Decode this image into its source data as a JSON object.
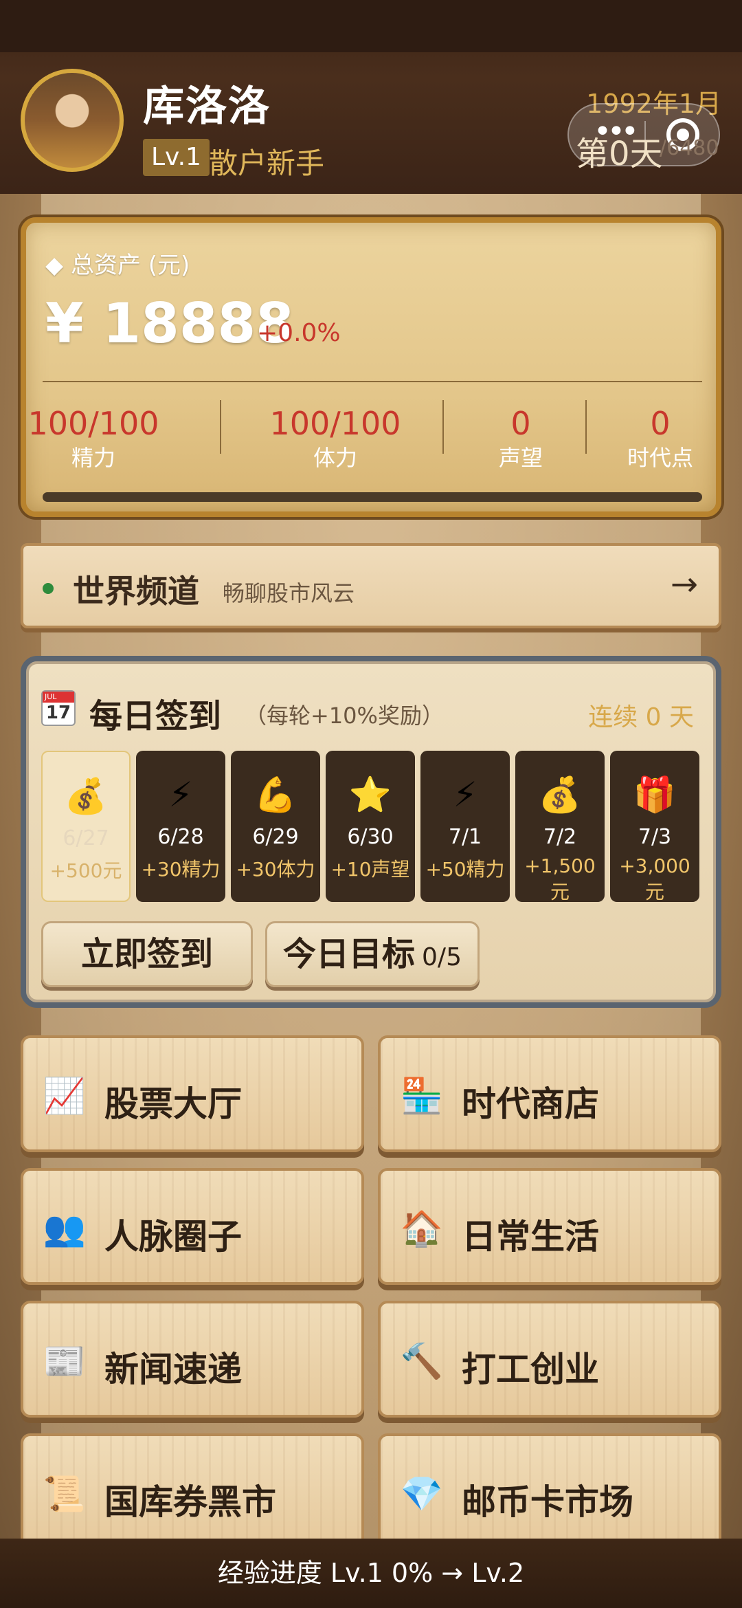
{
  "header": {
    "username": "库洛洛",
    "level": "Lv.1",
    "title": "散户新手",
    "date": "1992年1月",
    "day": "第0天",
    "day_total": "/6480"
  },
  "assets": {
    "label": "◆ 总资产 (元)",
    "value": "¥ 18888",
    "change": "+0.0%",
    "stats": [
      {
        "value": "100/100",
        "label": "精力"
      },
      {
        "value": "100/100",
        "label": "体力"
      },
      {
        "value": "0",
        "label": "声望"
      },
      {
        "value": "0",
        "label": "时代点"
      }
    ]
  },
  "channel": {
    "title": "世界频道",
    "subtitle": "畅聊股市风云",
    "arrow": "→"
  },
  "checkin": {
    "cal_month": "JUL",
    "cal_day": "17",
    "title": "每日签到",
    "bonus": "（每轮+10%奖励）",
    "streak": "连续 0 天",
    "days": [
      {
        "icon": "money-bag-icon",
        "glyph": "💰",
        "date": "6/27",
        "reward": "+500元",
        "done": true
      },
      {
        "icon": "lightning-icon",
        "glyph": "⚡",
        "date": "6/28",
        "reward": "+30精力",
        "done": false
      },
      {
        "icon": "muscle-icon",
        "glyph": "💪",
        "date": "6/29",
        "reward": "+30体力",
        "done": false
      },
      {
        "icon": "star-icon",
        "glyph": "⭐",
        "date": "6/30",
        "reward": "+10声望",
        "done": false
      },
      {
        "icon": "lightning-icon",
        "glyph": "⚡",
        "date": "7/1",
        "reward": "+50精力",
        "done": false
      },
      {
        "icon": "money-bag-icon",
        "glyph": "💰",
        "date": "7/2",
        "reward": "+1,500元",
        "done": false
      },
      {
        "icon": "gift-icon",
        "glyph": "🎁",
        "date": "7/3",
        "reward": "+3,000元",
        "done": false
      }
    ],
    "sign_button": "立即签到",
    "goal_button": "今日目标",
    "goal_progress": "0/5"
  },
  "menu": [
    {
      "label": "股票大厅",
      "icon": "chart-icon",
      "glyph": "📈"
    },
    {
      "label": "时代商店",
      "icon": "store-icon",
      "glyph": "🏪"
    },
    {
      "label": "人脉圈子",
      "icon": "people-icon",
      "glyph": "👥"
    },
    {
      "label": "日常生活",
      "icon": "house-icon",
      "glyph": "🏠"
    },
    {
      "label": "新闻速递",
      "icon": "newspaper-icon",
      "glyph": "📰"
    },
    {
      "label": "打工创业",
      "icon": "hammer-icon",
      "glyph": "🔨"
    },
    {
      "label": "国库券黑市",
      "icon": "scroll-icon",
      "glyph": "📜"
    },
    {
      "label": "邮币卡市场",
      "icon": "gem-icon",
      "glyph": "💎"
    }
  ],
  "footer": {
    "text": "经验进度  Lv.1  0% → Lv.2"
  },
  "colors": {
    "accent_gold": "#d8a84a",
    "value_red": "#c8372c",
    "wood_dark": "#3a2417"
  }
}
